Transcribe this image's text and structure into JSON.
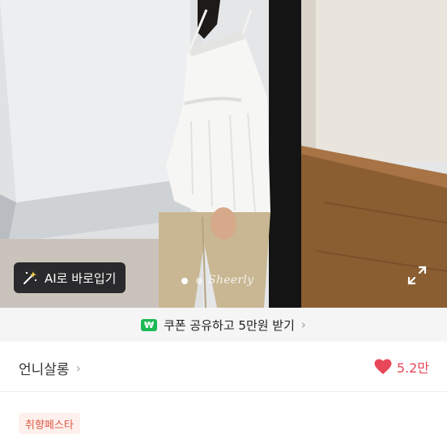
{
  "hero": {
    "ai_button_label": "AI로 바로입기",
    "watermark": "Sheerly",
    "pager_total": 2,
    "pager_active": 1
  },
  "coupon": {
    "icon_text": "₩",
    "label": "쿠폰 공유하고 5만원 받기"
  },
  "shop": {
    "name": "언니살롱",
    "likes": "5.2만"
  },
  "tag": "취향페스타",
  "description_preview": "",
  "colors": {
    "like_red": "#e8475a",
    "tag_text": "#e05a45",
    "tag_bg": "#fdf0ed",
    "coupon_green": "#1db954"
  },
  "icons": [
    "magic-wand-icon",
    "expand-icon",
    "chevron-right-icon",
    "heart-icon",
    "won-coupon-icon"
  ]
}
